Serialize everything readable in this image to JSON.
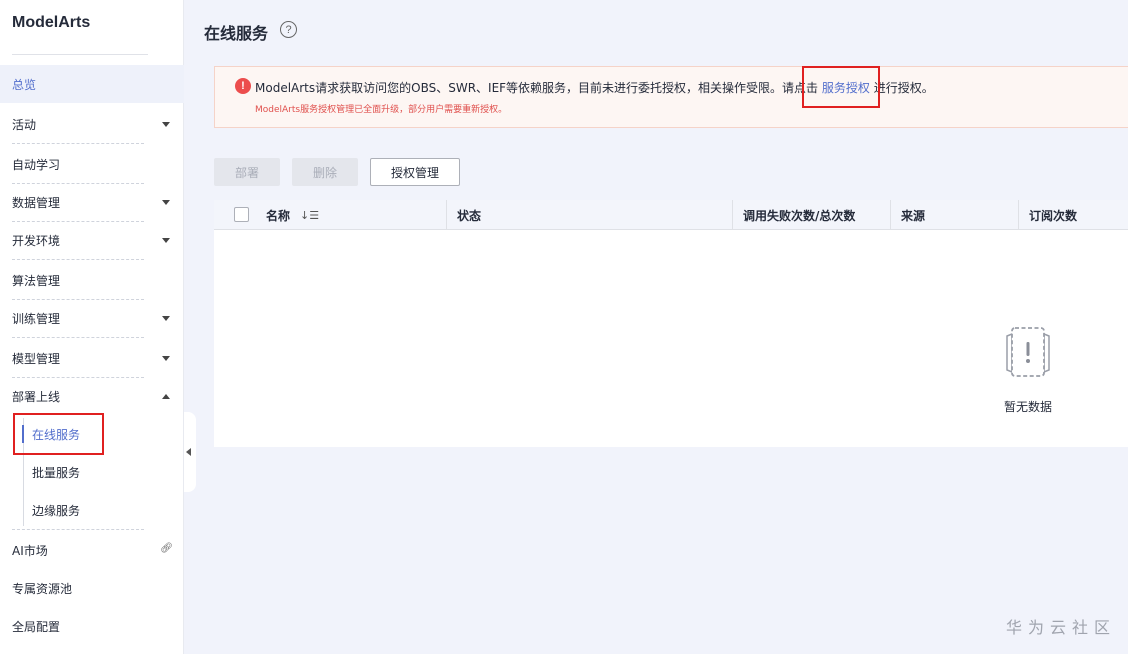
{
  "app": {
    "logo": "ModelArts"
  },
  "sidebar": {
    "items": [
      {
        "label": "总览"
      },
      {
        "label": "活动"
      },
      {
        "label": "自动学习"
      },
      {
        "label": "数据管理"
      },
      {
        "label": "开发环境"
      },
      {
        "label": "算法管理"
      },
      {
        "label": "训练管理"
      },
      {
        "label": "模型管理"
      },
      {
        "label": "部署上线"
      },
      {
        "label": "AI市场"
      },
      {
        "label": "专属资源池"
      },
      {
        "label": "全局配置"
      }
    ],
    "sub_items": [
      {
        "label": "在线服务"
      },
      {
        "label": "批量服务"
      },
      {
        "label": "边缘服务"
      }
    ]
  },
  "page": {
    "title": "在线服务",
    "help_icon": "?"
  },
  "alert": {
    "icon": "!",
    "text_before": "ModelArts请求获取访问您的OBS、SWR、IEF等依赖服务，目前未进行委托授权，相关操作受限。请点击",
    "link": "服务授权",
    "text_after": "进行授权。",
    "sub": "ModelArts服务授权管理已全面升级，部分用户需要重新授权。"
  },
  "toolbar": {
    "deploy": "部署",
    "delete": "删除",
    "auth_manage": "授权管理"
  },
  "table": {
    "columns": [
      "名称",
      "状态",
      "调用失败次数/总次数",
      "来源",
      "订阅次数"
    ],
    "sort_icon": "↓☰",
    "empty_text": "暂无数据"
  },
  "watermark": "华为云社区",
  "colors": {
    "accent": "#526ecc",
    "alert_red": "#ec4d4d",
    "highlight_box": "#e02020"
  }
}
